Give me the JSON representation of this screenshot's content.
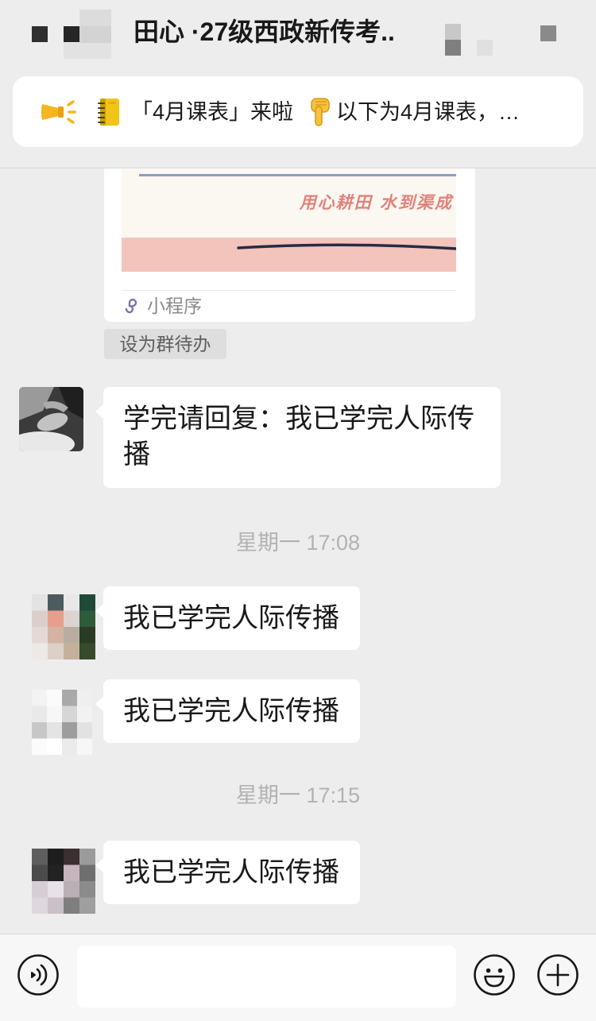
{
  "header": {
    "title": "田心 ·27级西政新传考..",
    "back_icon": "back-button",
    "more_icon": "more-button"
  },
  "announcement": {
    "icon": "megaphone-icon",
    "notebook_icon": "notebook-icon",
    "title": "「4月课表」来啦",
    "pointer_icon": "hand-pointing-down-icon",
    "preview": "以下为4月课表，…"
  },
  "mini_program": {
    "image_caption": "用心耕田 水到渠成",
    "source_icon": "mini-program-icon",
    "source_label": "小程序"
  },
  "group_todo": {
    "label": "设为群待办"
  },
  "chat": {
    "messages": [
      "学完请回复：我已学完人际传播",
      "我已学完人际传播",
      "我已学完人际传播",
      "我已学完人际传播"
    ],
    "timestamps": [
      "星期一 17:08",
      "星期一 17:15"
    ]
  },
  "input_bar": {
    "value": "",
    "voice_icon": "voice-icon",
    "emoji_icon": "emoji-icon",
    "more_icon": "plus-icon"
  },
  "colors": {
    "chat_background": "#ededed",
    "bubble": "#ffffff",
    "timestamp": "#b2b2b2",
    "input_bar": "#f7f7f7",
    "announcement_icon": "#f6b520"
  }
}
